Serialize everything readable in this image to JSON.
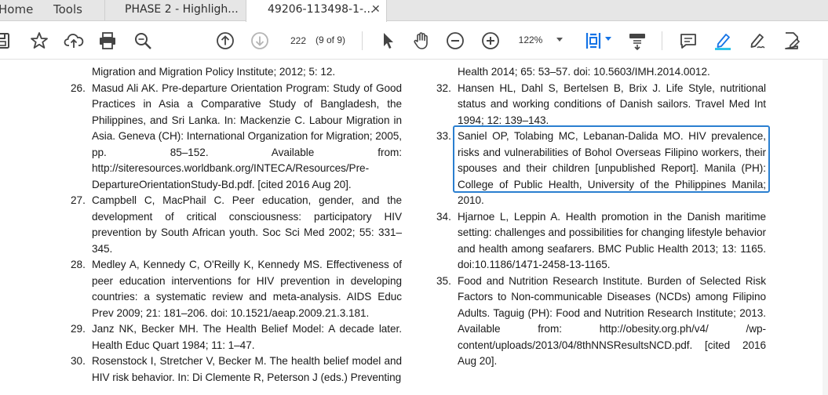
{
  "nav": {
    "home": "Home",
    "tools": "Tools"
  },
  "tabs": [
    {
      "label": "PHASE 2 - Highligh..."
    },
    {
      "label": "49206-113498-1-...",
      "close": "✕"
    }
  ],
  "toolbar": {
    "page_number": "222",
    "page_count": "(9 of 9)",
    "zoom": "122%",
    "icons": [
      "save-icon",
      "star-icon",
      "cloud-upload-icon",
      "print-icon",
      "zoom-search-icon",
      "page-up-icon",
      "page-down-icon",
      "select-cursor-icon",
      "hand-tool-icon",
      "zoom-out-icon",
      "zoom-in-icon",
      "fit-page-icon",
      "scroll-mode-icon",
      "comment-icon",
      "highlight-pen-icon",
      "sign-icon",
      "fill-sign-icon"
    ]
  },
  "left_column": [
    {
      "num": "",
      "text": "Migration and Migration Policy Institute; 2012; 5: 12."
    },
    {
      "num": "26.",
      "text": "Masud Ali AK. Pre-departure Orientation Program: Study of Good Practices in Asia a Comparative Study of Bangladesh, the Philippines, and Sri Lanka. In: Mackenzie C. Labour Migration in Asia.  Geneva (CH): International Organization for Migration; 2005, pp. 85–152. Available from:  http://siteresources.worldbank.org/INTECA/Resources/Pre-DepartureOrientationStudy-Bd.pdf. [cited 2016 Aug 20]."
    },
    {
      "num": "27.",
      "text": "Campbell C, MacPhail C. Peer education, gender, and the development of critical consciousness: participatory HIV prevention by South African youth. Soc Sci Med 2002; 55: 331–345."
    },
    {
      "num": "28.",
      "text": "Medley A, Kennedy C, O'Reilly K, Kennedy MS. Effectiveness of peer education interventions for HIV prevention in developing countries: a systematic review and meta-analysis. AIDS Educ Prev 2009; 21: 181–206. doi: 10.1521/aeap.2009.21.3.181."
    },
    {
      "num": "29.",
      "text": "Janz NK, Becker MH. The Health Belief Model: A decade later. Health Educ Quart 1984; 11: 1–47."
    },
    {
      "num": "30.",
      "text": "Rosenstock I, Stretcher V, Becker M. The health belief model and HIV risk behavior. In: Di Clemente R, Peterson J (eds.) Preventing"
    }
  ],
  "right_column": [
    {
      "num": "",
      "text": "Health 2014; 65: 53–57. doi: 10.5603/IMH.2014.0012."
    },
    {
      "num": "32.",
      "text": "Hansen HL, Dahl S, Bertelsen B, Brix J. Life Style, nutritional status and working conditions of Danish sailors. Travel Med Int 1994; 12: 139–143."
    },
    {
      "num": "33.",
      "text": "Saniel OP, Tolabing MC, Lebanan-Dalida MO. HIV prevalence, risks and vulnerabilities of Bohol Overseas Filipino workers, their spouses and their children [unpublished Report]. Manila (PH): College of Public Health, University of the Philippines Manila; 2010."
    },
    {
      "num": "34.",
      "text": "Hjarnoe L, Leppin A. Health promotion in the Danish maritime setting: challenges and possibilities for changing lifestyle behavior and health among seafarers. BMC Public Health 2013; 13: 1165. doi:10.1186/1471-2458-13-1165."
    },
    {
      "num": "35.",
      "text": "Food and Nutrition Research Institute. Burden of Selected Risk Factors to Non-communicable Diseases (NCDs) among Filipino Adults. Taguig (PH): Food and Nutrition Research Institute; 2013. Available from: http://obesity.org.ph/v4/ /wp-content/uploads/2013/04/8thNNSResultsNCD.pdf. [cited 2016 Aug 20]."
    }
  ],
  "colors": {
    "highlight_border": "#2a7fd0",
    "tab_bar": "#e6e6e6",
    "accent_blue": "#1473e6"
  }
}
